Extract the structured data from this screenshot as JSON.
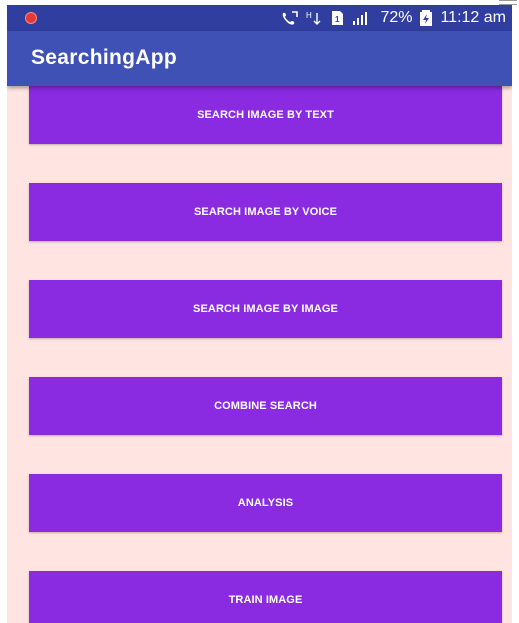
{
  "status_bar": {
    "battery_percent": "72%",
    "time": "11:12 am",
    "icons": [
      "notification-icon",
      "call-icon",
      "data-icon",
      "sim-icon",
      "signal-icon",
      "battery-icon"
    ]
  },
  "app_bar": {
    "title": "SearchingApp"
  },
  "buttons": [
    {
      "label": "SEARCH IMAGE BY TEXT"
    },
    {
      "label": "SEARCH IMAGE BY VOICE"
    },
    {
      "label": "SEARCH IMAGE BY IMAGE"
    },
    {
      "label": "COMBINE SEARCH"
    },
    {
      "label": "ANALYSIS"
    },
    {
      "label": "TRAIN IMAGE"
    }
  ],
  "colors": {
    "status_bar": "#303f9f",
    "app_bar": "#3f51b5",
    "background": "#ffe4e1",
    "button": "#8a2be2",
    "button_text": "#ffffff"
  }
}
